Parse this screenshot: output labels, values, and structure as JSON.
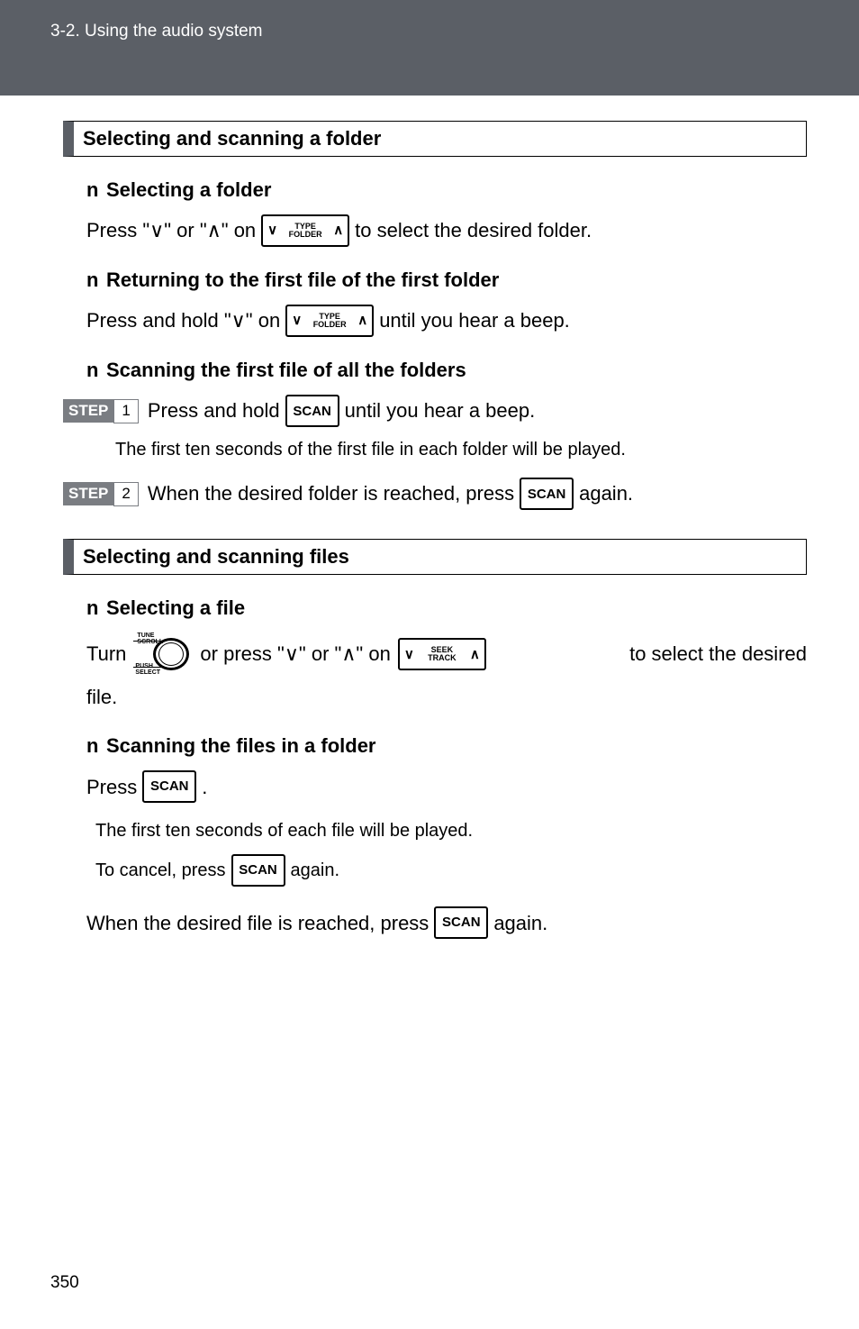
{
  "header": {
    "breadcrumb": "3-2. Using the audio system"
  },
  "section_a": {
    "title": "Selecting and scanning a folder",
    "sub1": {
      "heading": "Selecting a folder",
      "pre": "Press \"∨\" or \"∧\" on",
      "btn_top": "TYPE",
      "btn_bot": "FOLDER",
      "post": "to select the desired folder."
    },
    "sub2": {
      "heading": "Returning to the first file of the first folder",
      "pre": "Press and hold \"∨\" on",
      "btn_top": "TYPE",
      "btn_bot": "FOLDER",
      "post": "until you hear a beep."
    },
    "sub3": {
      "heading": "Scanning the first file of all the folders",
      "step1_pre": "Press and hold",
      "step1_post": "until you hear a beep.",
      "step1_note": "The first ten seconds of the first file in each folder will be played.",
      "step2_pre": "When the desired folder is reached, press",
      "step2_post": "again."
    }
  },
  "section_b": {
    "title": "Selecting and scanning files",
    "sub1": {
      "heading": "Selecting a file",
      "turn": "Turn",
      "mid": "or press \"∨\" or \"∧\" on",
      "btn_top": "SEEK",
      "btn_bot": "TRACK",
      "post": "to select the desired",
      "file": "file."
    },
    "sub2": {
      "heading": "Scanning the files in a folder",
      "press": "Press",
      "dot": ".",
      "note": "The first ten seconds of each file will be played.",
      "cancel_pre": "To cancel, press",
      "cancel_post": "again.",
      "final_pre": "When the desired file is reached, press",
      "final_post": "again."
    }
  },
  "buttons": {
    "scan": "SCAN"
  },
  "steps": {
    "label": "STEP",
    "one": "1",
    "two": "2"
  },
  "knob": {
    "top": "TUNE\nSCROLL",
    "bot": "PUSH\nSELECT"
  },
  "page": "350",
  "bullet": "n"
}
